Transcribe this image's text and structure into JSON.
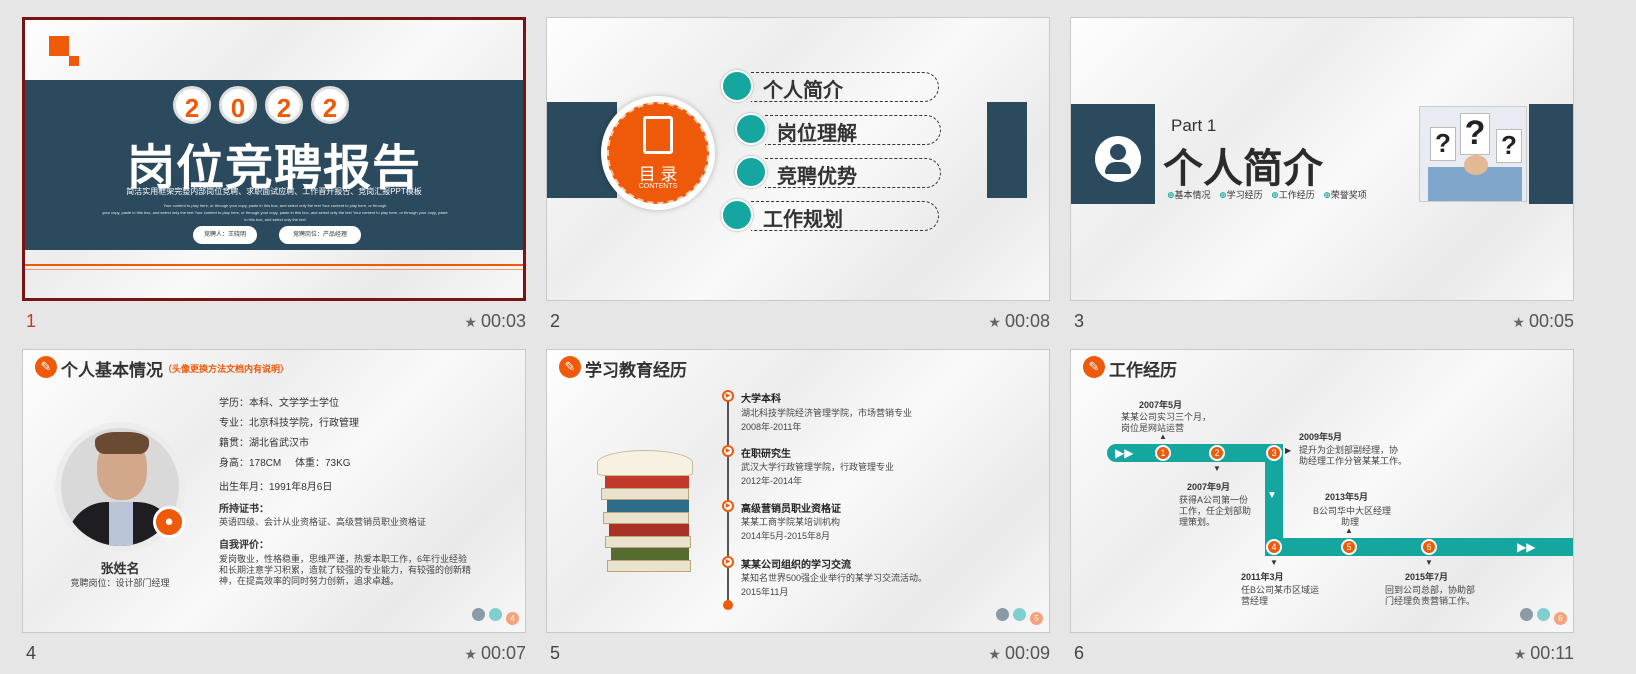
{
  "slides": [
    {
      "number": "1",
      "time": "00:03",
      "year_digits": [
        "2",
        "0",
        "2",
        "2"
      ],
      "title": "岗位竞聘报告",
      "subtitle": "简洁实用框架完整内部岗位竞聘、求职面试应聘、工作晋升报告、竞岗汇报PPT模板",
      "body_line1": "Your content to play here, or through your copy, paste in this box, and select only the text Your content to play here, or through",
      "body_line2": "your copy, paste in this box, and select only the text Your content to play here, or through your copy, paste in this box, and select only the text Your content to play here, or through your copy, paste",
      "body_line3": "in this box, and select only the text",
      "pill_left": "竞聘人：王晓明",
      "pill_right": "竞聘岗位：产品经理"
    },
    {
      "number": "2",
      "time": "00:08",
      "circle_main": "目 录",
      "circle_sub": "CONTENTS",
      "menu": [
        "个人简介",
        "岗位理解",
        "竞聘优势",
        "工作规划"
      ]
    },
    {
      "number": "3",
      "time": "00:05",
      "part": "Part 1",
      "title": "个人简介",
      "tags": [
        "基本情况",
        "学习经历",
        "工作经历",
        "荣誉奖项"
      ]
    },
    {
      "number": "4",
      "time": "00:07",
      "header": "个人基本情况",
      "note": "（头像更换方法文档内有说明）",
      "name": "张姓名",
      "position": "竞聘岗位：设计部门经理",
      "edu": "学历：本科、文学学士学位",
      "major": "专业：北京科技学院，行政管理",
      "origin": "籍贯：湖北省武汉市",
      "height": "身高：178CM",
      "weight": "体重：73KG",
      "birth": "出生年月：1991年8月6日",
      "cert_label": "所持证书：",
      "cert": "英语四级、会计从业资格证、高级营销员职业资格证",
      "eval_label": "自我评价：",
      "eval1": "爱岗敬业，性格稳重，思维严谨，热爱本职工作，6年行业经验",
      "eval2": "和长期注意学习积累，造就了较强的专业能力，有较强的创新精",
      "eval3": "神，在提高效率的同时努力创新，追求卓越。",
      "page_badge": "4"
    },
    {
      "number": "5",
      "time": "00:09",
      "header": "学习教育经历",
      "entries": [
        {
          "title": "大学本科",
          "desc": "湖北科技学院经济管理学院，市场营销专业",
          "date": "2008年-2011年"
        },
        {
          "title": "在职研究生",
          "desc": "武汉大学行政管理学院，行政管理专业",
          "date": "2012年-2014年"
        },
        {
          "title": "高级营销员职业资格证",
          "desc": "某某工商学院某培训机构",
          "date": "2014年5月-2015年8月"
        },
        {
          "title": "某某公司组织的学习交流",
          "desc": "某知名世界500强企业举行的某学习交流活动。",
          "date": "2015年11月"
        }
      ],
      "page_badge": "5"
    },
    {
      "number": "6",
      "time": "00:11",
      "header": "工作经历",
      "events": [
        {
          "date": "2007年5月",
          "line1": "某某公司实习三个月，",
          "line2": "岗位是网站运营",
          "line3": ""
        },
        {
          "date": "2007年9月",
          "line1": "获得A公司第一份",
          "line2": "工作，任企划部助",
          "line3": "理策划。"
        },
        {
          "date": "2009年5月",
          "line1": "提升为企划部副经理，协",
          "line2": "助经理工作分管某某工作。",
          "line3": ""
        },
        {
          "date": "2013年5月",
          "line1": "B公司华中大区经理",
          "line2": "助理",
          "line3": ""
        },
        {
          "date": "2011年3月",
          "line1": "任B公司某市区域运",
          "line2": "营经理",
          "line3": ""
        },
        {
          "date": "2015年7月",
          "line1": "回到公司总部，协助部",
          "line2": "门经理负责营销工作。",
          "line3": ""
        }
      ],
      "step_numbers": [
        "1",
        "2",
        "3",
        "4",
        "5",
        "6"
      ],
      "page_badge": "6"
    }
  ],
  "colors": {
    "navy": "#2b4a5e",
    "orange": "#ee5a0a",
    "teal": "#16a6a0",
    "selected_border": "#7a1313"
  }
}
